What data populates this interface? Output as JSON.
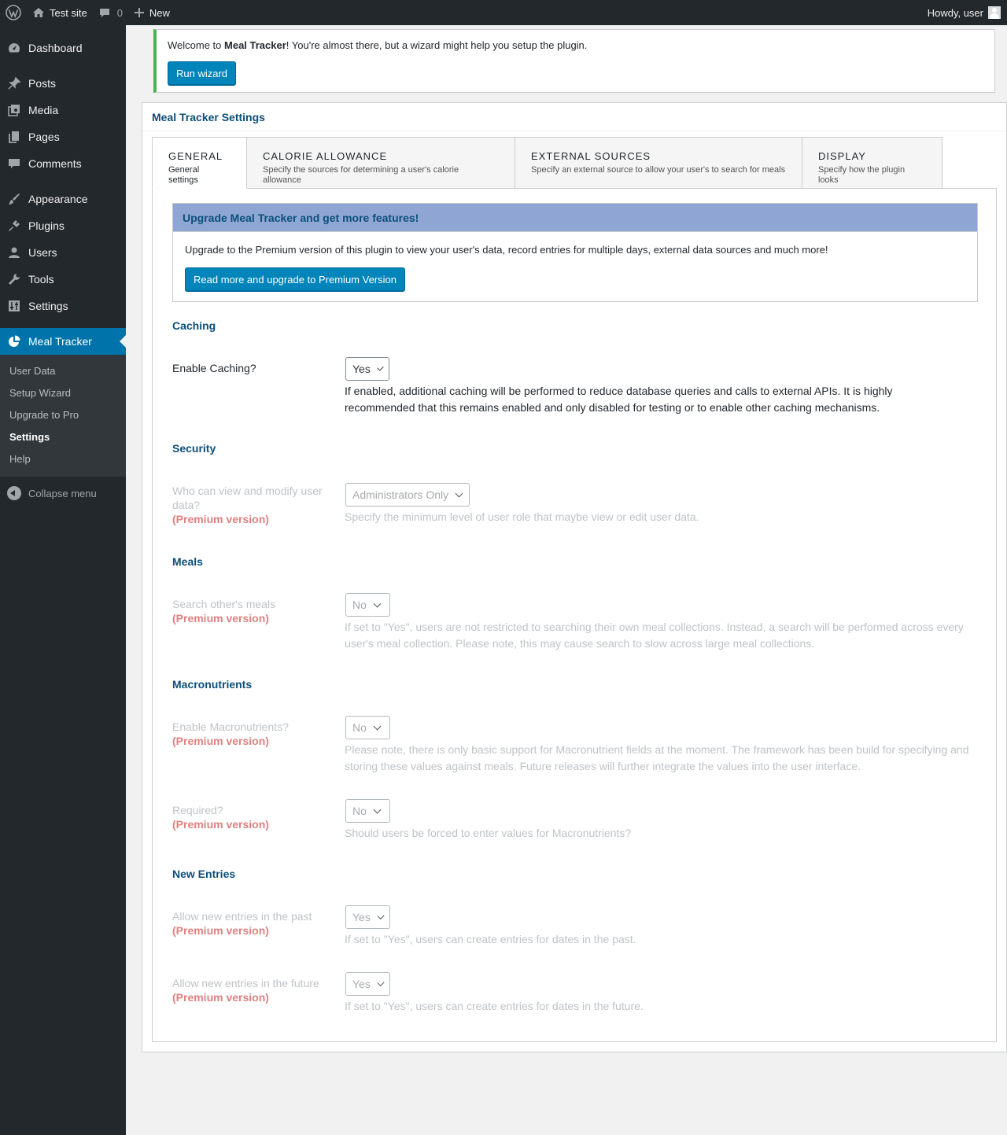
{
  "adminbar": {
    "site_name": "Test site",
    "comments_count": "0",
    "new_label": "New",
    "howdy": "Howdy, user"
  },
  "sidebar": {
    "items": [
      {
        "label": "Dashboard",
        "icon": "dashboard-icon"
      },
      {
        "label": "Posts",
        "icon": "pin-icon"
      },
      {
        "label": "Media",
        "icon": "media-icon"
      },
      {
        "label": "Pages",
        "icon": "pages-icon"
      },
      {
        "label": "Comments",
        "icon": "comment-icon"
      },
      {
        "label": "Appearance",
        "icon": "brush-icon"
      },
      {
        "label": "Plugins",
        "icon": "plug-icon"
      },
      {
        "label": "Users",
        "icon": "user-icon"
      },
      {
        "label": "Tools",
        "icon": "wrench-icon"
      },
      {
        "label": "Settings",
        "icon": "sliders-icon"
      },
      {
        "label": "Meal Tracker",
        "icon": "pie-chart-icon"
      }
    ],
    "submenu": [
      "User Data",
      "Setup Wizard",
      "Upgrade to Pro",
      "Settings",
      "Help"
    ],
    "collapse_label": "Collapse menu"
  },
  "notice": {
    "text_before": "Welcome to ",
    "text_bold": "Meal Tracker",
    "text_after": "! You're almost there, but a wizard might help you setup the plugin.",
    "button": "Run wizard"
  },
  "settings": {
    "title": "Meal Tracker Settings",
    "tabs": [
      {
        "title": "GENERAL",
        "subtitle": "General settings"
      },
      {
        "title": "CALORIE ALLOWANCE",
        "subtitle": "Specify the sources for determining a user's calorie allowance"
      },
      {
        "title": "EXTERNAL SOURCES",
        "subtitle": "Specify an external source to allow your user's to search for meals"
      },
      {
        "title": "DISPLAY",
        "subtitle": "Specify how the plugin looks"
      }
    ],
    "upgrade": {
      "heading": "Upgrade Meal Tracker and get more features!",
      "text": "Upgrade to the Premium version of this plugin to view your user's data, record entries for multiple days, external data sources and much more!",
      "button": "Read more and upgrade to Premium Version"
    },
    "premium_label": "(Premium version)",
    "sections": {
      "caching": {
        "title": "Caching",
        "label": "Enable Caching?",
        "value": "Yes",
        "desc": "If enabled, additional caching will be performed to reduce database queries and calls to external APIs. It is highly recommended that this remains enabled and only disabled for testing or to enable other caching mechanisms."
      },
      "security": {
        "title": "Security",
        "label": "Who can view and modify user data?",
        "value": "Administrators Only",
        "desc": "Specify the minimum level of user role that maybe view or edit user data."
      },
      "meals": {
        "title": "Meals",
        "label": "Search other's meals",
        "value": "No",
        "desc": "If set to \"Yes\", users are not restricted to searching their own meal collections. Instead, a search will be performed across every user's meal collection. Please note, this may cause search to slow across large meal collections."
      },
      "macros": {
        "title": "Macronutrients",
        "label": "Enable Macronutrients?",
        "value": "No",
        "desc": "Please note, there is only basic support for Macronutrient fields at the moment. The framework has been build for specifying and storing these values against meals. Future releases will further integrate the values into the user interface.",
        "required_label": "Required?",
        "required_value": "No",
        "required_desc": "Should users be forced to enter values for Macronutrients?"
      },
      "entries": {
        "title": "New Entries",
        "past_label": "Allow new entries in the past",
        "past_value": "Yes",
        "past_desc": "If set to \"Yes\", users can create entries for dates in the past.",
        "future_label": "Allow new entries in the future",
        "future_value": "Yes",
        "future_desc": "If set to \"Yes\", users can create entries for dates in the future."
      }
    }
  },
  "colors": {
    "admin_bg": "#23282d",
    "accent": "#0073aa",
    "notice_border": "#46b450",
    "premium": "#e08080",
    "upgrade_header": "#8fa6d4"
  }
}
